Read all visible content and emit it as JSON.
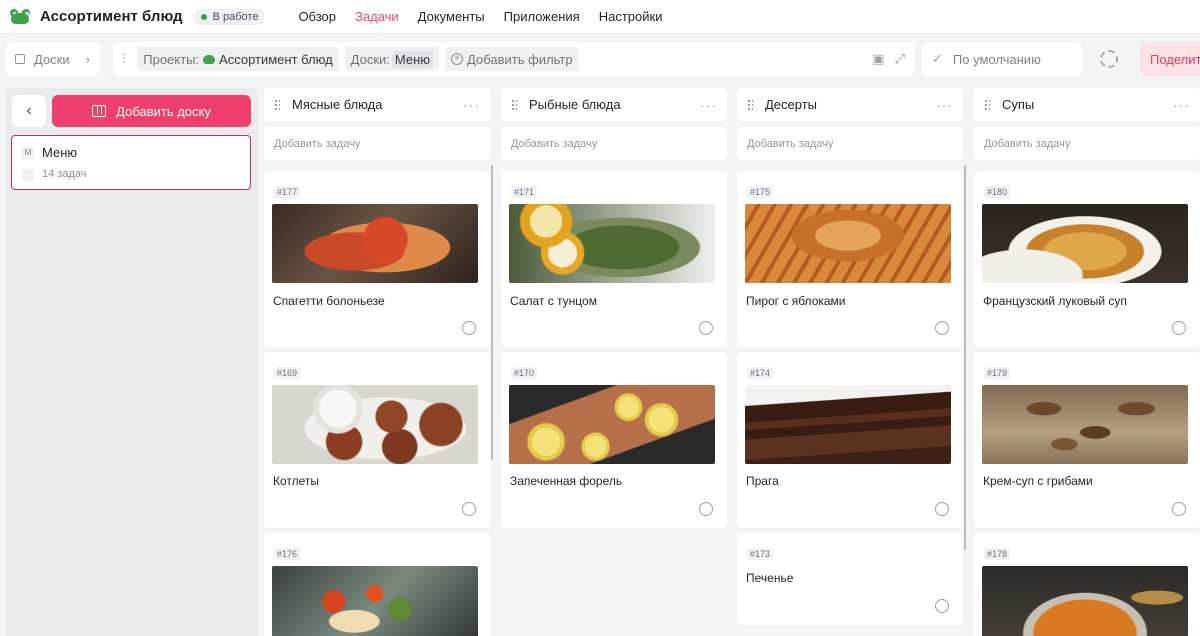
{
  "app": {
    "title": "Ассортимент блюд",
    "status": "В работе"
  },
  "nav": [
    {
      "label": "Обзор",
      "active": false
    },
    {
      "label": "Задачи",
      "active": true
    },
    {
      "label": "Документы",
      "active": false
    },
    {
      "label": "Приложения",
      "active": false
    },
    {
      "label": "Настройки",
      "active": false
    }
  ],
  "toolbar": {
    "boards_label": "Доски",
    "projects_label": "Проекты:",
    "project_value": "Ассортимент блюд",
    "boards_filter_label": "Доски:",
    "boards_filter_value": "Меню",
    "add_filter": "Добавить фильтр",
    "sort_value": "По умолчанию",
    "share": "Поделит"
  },
  "sidebar": {
    "add_board": "Добавить доску",
    "board": {
      "initial": "М",
      "name": "Меню",
      "count": "14 задач"
    }
  },
  "columns": [
    {
      "title": "Мясные блюда",
      "add_task": "Добавить задачу",
      "cards": [
        {
          "id": "#177",
          "title": "Спагетти болоньезе",
          "image": "spaghetti"
        },
        {
          "id": "#169",
          "title": "Котлеты",
          "image": "cutlets"
        },
        {
          "id": "#176",
          "title": "",
          "image": "roasted-vegetables"
        }
      ]
    },
    {
      "title": "Рыбные блюда",
      "add_task": "Добавить задачу",
      "cards": [
        {
          "id": "#171",
          "title": "Салат с тунцом",
          "image": "tuna-salad"
        },
        {
          "id": "#170",
          "title": "Запеченная форель",
          "image": "baked-trout"
        }
      ]
    },
    {
      "title": "Десерты",
      "add_task": "Добавить задачу",
      "cards": [
        {
          "id": "#175",
          "title": "Пирог с яблоками",
          "image": "apple-pie"
        },
        {
          "id": "#174",
          "title": "Прага",
          "image": "praga-cake"
        },
        {
          "id": "#173",
          "title": "Печенье",
          "image": ""
        }
      ]
    },
    {
      "title": "Супы",
      "add_task": "Добавить задачу",
      "cards": [
        {
          "id": "#180",
          "title": "Французский луковый суп",
          "image": "onion-soup"
        },
        {
          "id": "#179",
          "title": "Крем-суп с грибами",
          "image": "mushroom-soup"
        },
        {
          "id": "#178",
          "title": "",
          "image": "pumpkin-soup"
        }
      ]
    }
  ],
  "colors": {
    "accent": "#ef3f6c",
    "active_nav": "#e8486a",
    "status_dot": "#35a04a"
  }
}
